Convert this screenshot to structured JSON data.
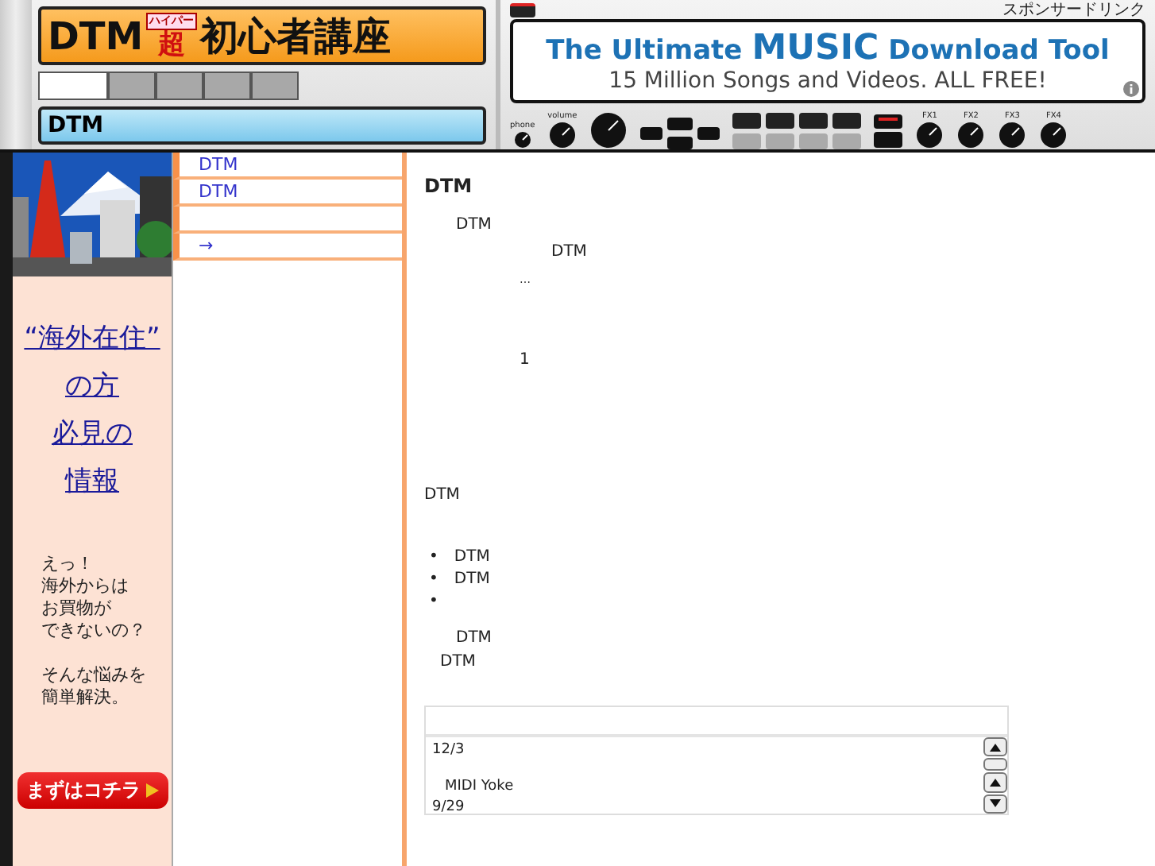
{
  "header": {
    "logo": {
      "latin": "DTM",
      "accent": "超",
      "ruby": "ハイパー",
      "rest": "初心者講座"
    },
    "tabs": [
      {
        "selected": true
      },
      {
        "selected": false
      },
      {
        "selected": false
      },
      {
        "selected": false
      },
      {
        "selected": false
      }
    ],
    "section_bar": "DTM",
    "sponsor_label": "スポンサードリンク",
    "ad": {
      "headline_before": "The Ultimate",
      "headline_emphasis": "MUSIC",
      "headline_after": "Download Tool",
      "subline": "15 Million Songs and Videos. ALL FREE!"
    },
    "mixer_labels": {
      "phone": "phone",
      "volume": "volume",
      "fx": [
        "FX1",
        "FX2",
        "FX3",
        "FX4"
      ]
    }
  },
  "sidebar": {
    "kind": "picture",
    "promo_links": [
      "“海外在住”",
      "の方",
      "必見の",
      "情報"
    ],
    "promo_paragraphs": [
      [
        "えっ！",
        "海外からは",
        "お買物が",
        "できないの？"
      ],
      [
        "そんな悩みを",
        "簡単解決。"
      ]
    ],
    "cta_button": "まずはコチラ"
  },
  "nav": {
    "items": [
      {
        "kind": "link",
        "text": "DTM"
      },
      {
        "kind": "link",
        "text": "DTM"
      },
      {
        "kind": "blank"
      },
      {
        "kind": "link",
        "text": "→"
      }
    ]
  },
  "content": {
    "title": "DTM",
    "lines": [
      {
        "kind": "lead",
        "text": "DTM"
      },
      {
        "kind": "aside",
        "text": "DTM"
      },
      {
        "kind": "ellipsis",
        "text": "…"
      },
      {
        "kind": "gap"
      },
      {
        "kind": "gap"
      },
      {
        "kind": "count",
        "text": "1"
      },
      {
        "kind": "gap"
      },
      {
        "kind": "gap"
      },
      {
        "kind": "gap"
      },
      {
        "kind": "gap"
      },
      {
        "kind": "plain",
        "text": "DTM"
      },
      {
        "kind": "gap"
      }
    ],
    "bullets": [
      {
        "marker": "•",
        "text": "DTM"
      },
      {
        "marker": "•",
        "text": "DTM"
      },
      {
        "marker": "•"
      }
    ],
    "after_bullets": [
      {
        "kind": "lead",
        "text": "DTM"
      },
      {
        "kind": "tab",
        "text": "DTM"
      }
    ],
    "news_box": {
      "lines": [
        {
          "text": "12/3",
          "kind": "date"
        },
        {
          "text": "MIDI Yoke",
          "kind": "entry"
        },
        {
          "text": "9/29",
          "kind": "date"
        }
      ]
    }
  }
}
